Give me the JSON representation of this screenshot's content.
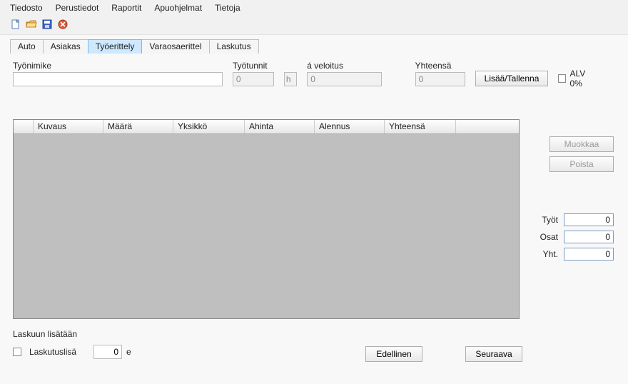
{
  "menu": {
    "items": [
      "Tiedosto",
      "Perustiedot",
      "Raportit",
      "Apuohjelmat",
      "Tietoja"
    ]
  },
  "tabs": {
    "items": [
      "Auto",
      "Asiakas",
      "Työerittely",
      "Varaosaerittel",
      "Laskutus"
    ],
    "active_index": 2
  },
  "form": {
    "tyonimike_label": "Työnimike",
    "tyotunnit_label": "Työtunnit",
    "tyotunnit_value": "0",
    "tyotunnit_unit": "h",
    "aveloitus_label": "á veloitus",
    "aveloitus_value": "0",
    "yhteensa_label": "Yhteensä",
    "yhteensa_value": "0",
    "lisaa_btn": "Lisää/Tallenna",
    "alv_label": "ALV 0%"
  },
  "grid": {
    "columns": [
      "",
      "Kuvaus",
      "Määrä",
      "Yksikkö",
      "Ahinta",
      "Alennus",
      "Yhteensä"
    ]
  },
  "side": {
    "muokkaa": "Muokkaa",
    "poista": "Poista"
  },
  "totals": {
    "tyot_label": "Työt",
    "tyot_value": "0",
    "osat_label": "Osat",
    "osat_value": "0",
    "yht_label": "Yht.",
    "yht_value": "0"
  },
  "footer": {
    "laskuun_label": "Laskuun lisätään",
    "laskutuslisa_label": "Laskutuslisä",
    "laskutuslisa_value": "0",
    "laskutuslisa_unit": "e",
    "prev": "Edellinen",
    "next": "Seuraava"
  }
}
